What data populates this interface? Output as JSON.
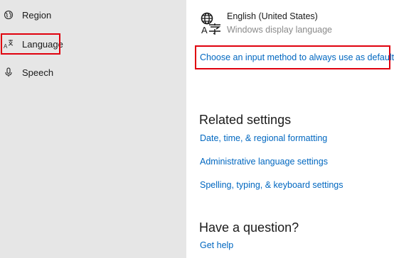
{
  "sidebar": {
    "items": [
      {
        "label": "Region",
        "icon": "region-globe-icon"
      },
      {
        "label": "Language",
        "icon": "language-icon"
      },
      {
        "label": "Speech",
        "icon": "microphone-icon"
      }
    ]
  },
  "language": {
    "name": "English (United States)",
    "subtitle": "Windows display language",
    "icon": "language-glyph-icon"
  },
  "input_method_link": "Choose an input method to always use as default",
  "related": {
    "title": "Related settings",
    "links": [
      "Date, time, & regional formatting",
      "Administrative language settings",
      "Spelling, typing, & keyboard settings"
    ]
  },
  "question": {
    "title": "Have a question?",
    "link": "Get help"
  },
  "colors": {
    "sidebar_bg": "#e6e6e6",
    "link": "#0067c0",
    "highlight": "#e0000d"
  }
}
